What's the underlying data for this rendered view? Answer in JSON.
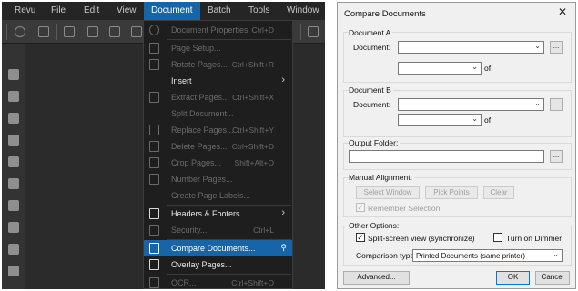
{
  "menubar": {
    "items": [
      "Revu",
      "File",
      "Edit",
      "View",
      "Document",
      "Batch",
      "Tools",
      "Window"
    ],
    "active_index": 4
  },
  "document_menu": {
    "items": [
      {
        "label": "Document Properties",
        "shortcut": "Ctrl+D",
        "icon": "info-icon",
        "enabled": false
      },
      {
        "label": "Page Setup...",
        "shortcut": "",
        "icon": "page-setup-icon",
        "enabled": false
      },
      {
        "label": "Rotate Pages...",
        "shortcut": "Ctrl+Shift+R",
        "icon": "rotate-pages-icon",
        "enabled": false
      },
      {
        "label": "Insert",
        "shortcut": "",
        "icon": "",
        "enabled": true,
        "submenu": true
      },
      {
        "label": "Extract Pages...",
        "shortcut": "Ctrl+Shift+X",
        "icon": "extract-pages-icon",
        "enabled": false
      },
      {
        "label": "Split Document...",
        "shortcut": "",
        "icon": "",
        "enabled": false
      },
      {
        "label": "Replace Pages...",
        "shortcut": "Ctrl+Shift+Y",
        "icon": "replace-pages-icon",
        "enabled": false
      },
      {
        "label": "Delete Pages...",
        "shortcut": "Ctrl+Shift+D",
        "icon": "delete-pages-icon",
        "enabled": false
      },
      {
        "label": "Crop Pages...",
        "shortcut": "Shift+Alt+O",
        "icon": "crop-pages-icon",
        "enabled": false
      },
      {
        "label": "Number Pages...",
        "shortcut": "",
        "icon": "number-pages-icon",
        "enabled": false
      },
      {
        "label": "Create Page Labels...",
        "shortcut": "",
        "icon": "",
        "enabled": false
      },
      {
        "label": "Headers & Footers",
        "shortcut": "",
        "icon": "headers-footers-icon",
        "enabled": true,
        "submenu": true
      },
      {
        "label": "Security...",
        "shortcut": "Ctrl+L",
        "icon": "lock-icon",
        "enabled": false
      },
      {
        "label": "Compare Documents...",
        "shortcut": "",
        "icon": "compare-documents-icon",
        "enabled": true,
        "highlighted": true,
        "pin": true
      },
      {
        "label": "Overlay Pages...",
        "shortcut": "",
        "icon": "overlay-pages-icon",
        "enabled": true
      },
      {
        "label": "OCR...",
        "shortcut": "Ctrl+Shift+O",
        "icon": "ocr-icon",
        "enabled": false
      }
    ]
  },
  "dialog": {
    "title": "Compare Documents",
    "close": "✕",
    "document_a": {
      "group_label": "Document A",
      "document_label": "Document:",
      "document_value": "",
      "browse": "...",
      "page_value": "",
      "of_label": "of"
    },
    "document_b": {
      "group_label": "Document B",
      "document_label": "Document:",
      "document_value": "",
      "browse": "...",
      "page_value": "",
      "of_label": "of"
    },
    "output_folder": {
      "group_label": "Output Folder:",
      "value": "",
      "browse": "..."
    },
    "manual_alignment": {
      "group_label": "Manual Alignment:",
      "select_window": "Select Window",
      "pick_points": "Pick Points",
      "clear": "Clear",
      "remember_selection": "Remember Selection",
      "remember_checked": true
    },
    "other_options": {
      "group_label": "Other Options:",
      "split_screen": "Split-screen view (synchronize)",
      "split_screen_checked": true,
      "dimmer": "Turn on Dimmer",
      "dimmer_checked": false,
      "comparison_type_label": "Comparison type:",
      "comparison_type_value": "Printed Documents (same printer)"
    },
    "advanced": "Advanced...",
    "ok": "OK",
    "cancel": "Cancel"
  },
  "colors": {
    "menu_highlight": "#1565a8",
    "app_background": "#2d2d2d",
    "dialog_background": "#f0f0f0",
    "default_button_border": "#0078d7"
  }
}
